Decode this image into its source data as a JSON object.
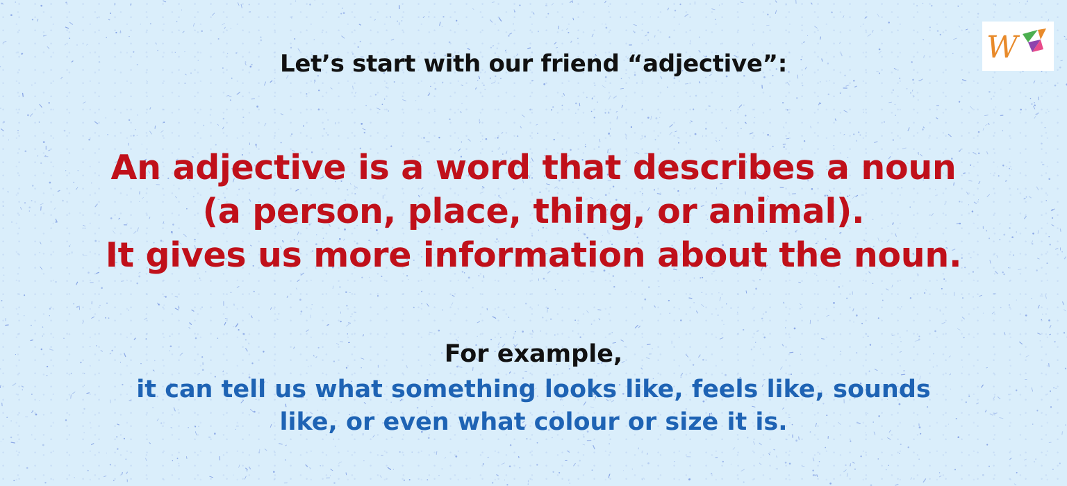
{
  "intro": {
    "text": "Let’s start with our friend “adjective”:"
  },
  "definition": {
    "lines": [
      "An adjective is a word that describes a noun",
      "(a person, place, thing, or animal).",
      "It gives us more information about the noun."
    ]
  },
  "example": {
    "lead": "For example,",
    "lines": [
      "it can tell us what something looks like, feels like, sounds",
      "like, or even what colour or size it is."
    ]
  },
  "logo": {
    "icon": "brand-logo-icon",
    "letter": "W"
  },
  "colors": {
    "background": "#daeefb",
    "speckle": "#3a5fd0",
    "heading_text": "#111111",
    "definition_text": "#c0101a",
    "example_text": "#1e63b4",
    "logo_orange": "#e88a2a",
    "logo_green": "#4caf50",
    "logo_purple": "#8e44ad",
    "logo_pink": "#e84a8a"
  }
}
